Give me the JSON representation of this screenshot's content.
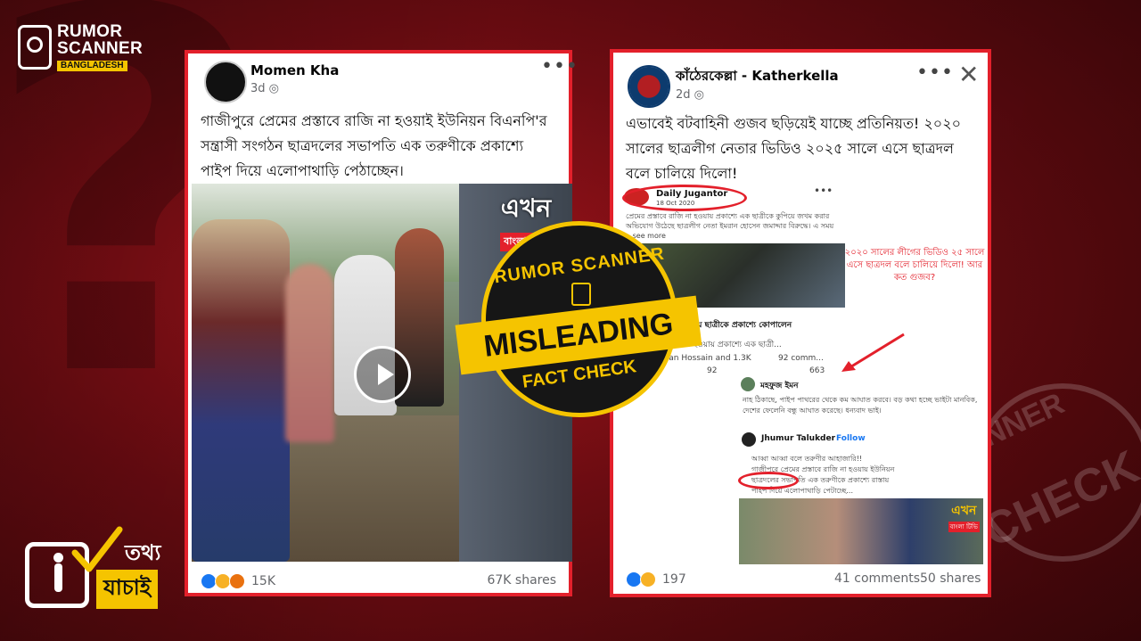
{
  "brand": {
    "line1": "RUMOR",
    "line2": "SCANNER",
    "line3": "BANGLADESH"
  },
  "bottom_logo": {
    "word1": "তথ্য",
    "word2": "যাচাই"
  },
  "stamp": {
    "top_text": "RUMOR SCANNER",
    "verdict": "MISLEADING",
    "bottom_text": "FACT CHECK"
  },
  "bg_stamp": {
    "word1": "NNER",
    "word2": "CHECK"
  },
  "colors": {
    "brand_red": "#e3202b",
    "stamp_yellow": "#f5c400",
    "fb_blue": "#1877f2"
  },
  "post1": {
    "author": "Momen Kha",
    "time": "3d",
    "text": "গাজীপুরে প্রেমের প্রস্তাবে রাজি না হওয়াই ইউনিয়ন বিএনপি'র সন্ত্রাসী সংগঠন ছাত্রদলের সভাপতি এক তরুণীকে প্রকাশ্যে পাইপ দিয়ে এলোপাথাড়ি পেঠাচ্ছেন।",
    "video_brand1": "এখন",
    "video_brand2": "বাংলা টিভি",
    "reactions": "15K",
    "shares": "67K shares"
  },
  "post2": {
    "author": "কাঁঠেরকেল্লা - Katherkella",
    "time": "2d",
    "text": "এভাবেই বটবাহিনী গুজব ছড়িয়েই যাচ্ছে প্রতিনিয়ত! ২০২০ সালের ছাত্রলীগ নেতার ভিডিও ২০২৫ সালে এসে ছাত্রদল বলে চালিয়ে দিলো!",
    "reactions": "197",
    "comments": "41 comments",
    "shares": "50 shares",
    "embed": {
      "page_name": "Daily Jugantor",
      "page_date": "18 Oct 2020",
      "caption": "প্রেমের প্রস্তাবে রাজি না হওয়ায় প্রকাশ্যে এক ছাত্রীকে কুপিয়ে জখম করার অভিযোগ উঠেছে ছাত্রলীগ নেতা ইমরান হোসেন জমাদ্দার বিরুদ্ধে। এ সময় ...see more",
      "red_note": "২০২০ সালের লীগের ভিডিও ২৫ সালে এসে ছাত্রদল বলে চালিয়ে দিলো! আর কত গুজব?",
      "link_title": "...করায় ছাত্রীকে প্রকাশ্যে কোপালেন",
      "link_sub": "...না হওয়ায় প্রকাশ্যে এক ছাত্রী...",
      "reactors": "...ran Hossain and 1.3K",
      "comment_count": "92 comm...",
      "stat1": "92",
      "stat3": "663",
      "commenter1": "মহফুজ ইমন",
      "comment1": "নাহ ঠিকাছে, পাইপ পাথরের থেকে কম আঘাত করবে। বড় কথা হচ্ছে ভাইটা মানবিক, দেশের ফেলেনি বন্ধু আঘাত করেছে। ধন্যবাদ ভাই।",
      "commenter2": "Jhumur Talukder",
      "follow": "Follow",
      "comment2_l1": "আব্বা আব্বা বলে তরুণীর আহাজারি!!",
      "comment2_l2": "গাজীপুরে প্রেমের প্রস্তাবে রাজি না হওয়ায় ইউনিয়ন",
      "comment2_l3": "ছাত্রদলের সভাপতি এক তরুণীকে প্রকাশ্যে রাস্তায়",
      "comment2_l4": "পাইপ দিয়ে এলোপাথাড়ি পেটাচ্ছে...",
      "video_brand1": "এখন",
      "video_brand2": "বাংলা টিভি"
    }
  }
}
